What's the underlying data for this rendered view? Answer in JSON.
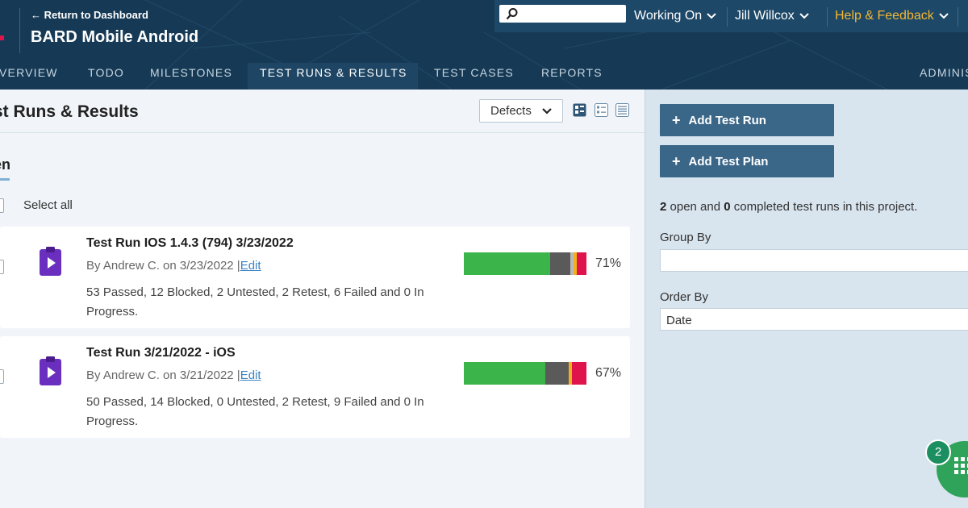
{
  "header": {
    "return_link": "← Return to Dashboard",
    "project_title": "BARD Mobile Android",
    "search_placeholder": "",
    "working_on": "Working On",
    "user_name": "Jill Willcox",
    "help": "Help & Feedback"
  },
  "nav": {
    "tabs": [
      {
        "label": "VERVIEW"
      },
      {
        "label": "TODO"
      },
      {
        "label": "MILESTONES"
      },
      {
        "label": "TEST RUNS & RESULTS"
      },
      {
        "label": "TEST CASES"
      },
      {
        "label": "REPORTS"
      },
      {
        "label": "ADMINIS"
      }
    ],
    "active_index": 3
  },
  "main": {
    "title": "st Runs & Results",
    "filter_value": "Defects",
    "section_title": "en",
    "select_all": "Select all",
    "runs": [
      {
        "title": "Test Run IOS 1.4.3 (794) 3/23/2022",
        "meta": "By Andrew C. on 3/23/2022 |",
        "edit": "Edit",
        "summary": "53 Passed, 12 Blocked, 2 Untested, 2 Retest, 6 Failed and 0 In Progress.",
        "percent": "71%",
        "progress": [
          {
            "status": "Passed",
            "count": 53,
            "color": "#3bb54a"
          },
          {
            "status": "Blocked",
            "count": 12,
            "color": "#5a5a5a"
          },
          {
            "status": "Untested",
            "count": 2,
            "color": "#b8b8b8"
          },
          {
            "status": "Retest",
            "count": 2,
            "color": "#f2b01e"
          },
          {
            "status": "Failed",
            "count": 6,
            "color": "#e0144c"
          }
        ]
      },
      {
        "title": "Test Run 3/21/2022 - iOS",
        "meta": "By Andrew C. on 3/21/2022 |",
        "edit": "Edit",
        "summary": "50 Passed, 14 Blocked, 0 Untested, 2 Retest, 9 Failed and 0 In Progress.",
        "percent": "67%",
        "progress": [
          {
            "status": "Passed",
            "count": 50,
            "color": "#3bb54a"
          },
          {
            "status": "Blocked",
            "count": 14,
            "color": "#5a5a5a"
          },
          {
            "status": "Untested",
            "count": 0,
            "color": "#b8b8b8"
          },
          {
            "status": "Retest",
            "count": 2,
            "color": "#f2b01e"
          },
          {
            "status": "Failed",
            "count": 9,
            "color": "#e0144c"
          }
        ]
      }
    ]
  },
  "sidebar": {
    "add_run": "Add Test Run",
    "add_plan": "Add Test Plan",
    "open_count": "2",
    "open_text": " open and ",
    "completed_count": "0",
    "completed_text": " completed test runs in this project.",
    "group_by_label": "Group By",
    "group_by_value": "",
    "order_by_label": "Order By",
    "order_by_value": "Date"
  },
  "chat": {
    "badge": "2"
  }
}
